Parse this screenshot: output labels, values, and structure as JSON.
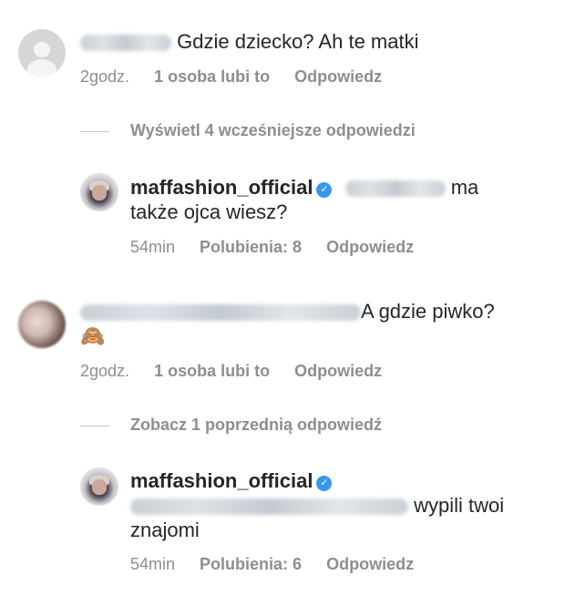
{
  "comment1": {
    "text": "Gdzie dziecko? Ah te matki",
    "time": "2godz.",
    "likes": "1 osoba lubi to",
    "reply": "Odpowiedz"
  },
  "replies1": {
    "toggle": "Wyświetl 4 wcześniejsze odpowiedzi"
  },
  "reply1": {
    "username": "maffashion_official",
    "text_after_mention": "ma",
    "text_line2": "także ojca wiesz?",
    "time": "54min",
    "likes": "Polubienia: 8",
    "reply": "Odpowiedz"
  },
  "comment2": {
    "text": "A gdzie piwko?",
    "emoji": "🙈",
    "time": "2godz.",
    "likes": "1 osoba lubi to",
    "reply": "Odpowiedz"
  },
  "replies2": {
    "toggle": "Zobacz 1 poprzednią odpowiedź"
  },
  "reply2": {
    "username": "maffashion_official",
    "text_after_blur": "wypili twoi",
    "text_line2": "znajomi",
    "time": "54min",
    "likes": "Polubienia: 6",
    "reply": "Odpowiedz"
  }
}
